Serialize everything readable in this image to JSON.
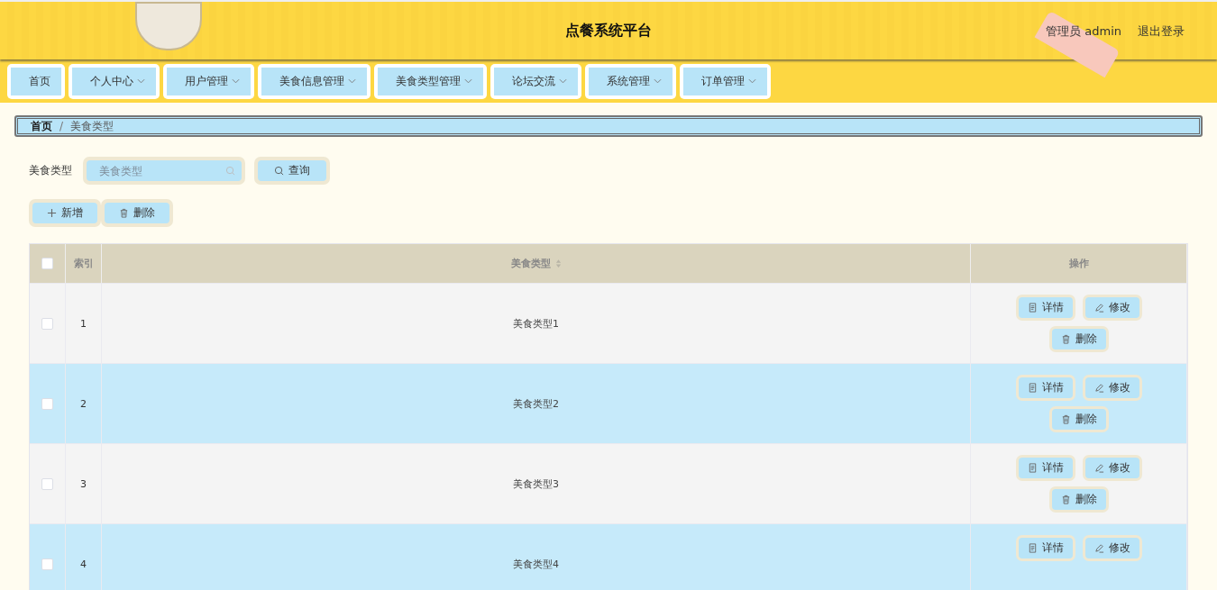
{
  "header": {
    "title": "点餐系统平台",
    "user": "管理员 admin",
    "logout": "退出登录"
  },
  "nav": [
    {
      "label": "首页",
      "has_menu": false
    },
    {
      "label": "个人中心",
      "has_menu": true
    },
    {
      "label": "用户管理",
      "has_menu": true
    },
    {
      "label": "美食信息管理",
      "has_menu": true
    },
    {
      "label": "美食类型管理",
      "has_menu": true
    },
    {
      "label": "论坛交流",
      "has_menu": true
    },
    {
      "label": "系统管理",
      "has_menu": true
    },
    {
      "label": "订单管理",
      "has_menu": true
    }
  ],
  "breadcrumb": {
    "separator": "/",
    "items": [
      "首页",
      "美食类型"
    ]
  },
  "search": {
    "label": "美食类型",
    "placeholder": "美食类型",
    "button": "查询"
  },
  "toolbar": [
    {
      "kind": "add",
      "label": "新增"
    },
    {
      "kind": "delete",
      "label": "删除"
    }
  ],
  "table": {
    "header_checked": false,
    "columns": [
      "索引",
      "美食类型",
      "操作"
    ],
    "rows": [
      {
        "checked": false,
        "index": "1",
        "name": "美食类型1",
        "actions": [
          {
            "kind": "detail",
            "label": "详情"
          },
          {
            "kind": "edit",
            "label": "修改"
          },
          {
            "kind": "delete",
            "label": "删除"
          }
        ]
      },
      {
        "checked": false,
        "index": "2",
        "name": "美食类型2",
        "actions": [
          {
            "kind": "detail",
            "label": "详情"
          },
          {
            "kind": "edit",
            "label": "修改"
          },
          {
            "kind": "delete",
            "label": "删除"
          }
        ]
      },
      {
        "checked": false,
        "index": "3",
        "name": "美食类型3",
        "actions": [
          {
            "kind": "detail",
            "label": "详情"
          },
          {
            "kind": "edit",
            "label": "修改"
          },
          {
            "kind": "delete",
            "label": "删除"
          }
        ]
      },
      {
        "checked": false,
        "index": "4",
        "name": "美食类型4",
        "actions": [
          {
            "kind": "detail",
            "label": "详情"
          },
          {
            "kind": "edit",
            "label": "修改"
          }
        ]
      }
    ]
  }
}
